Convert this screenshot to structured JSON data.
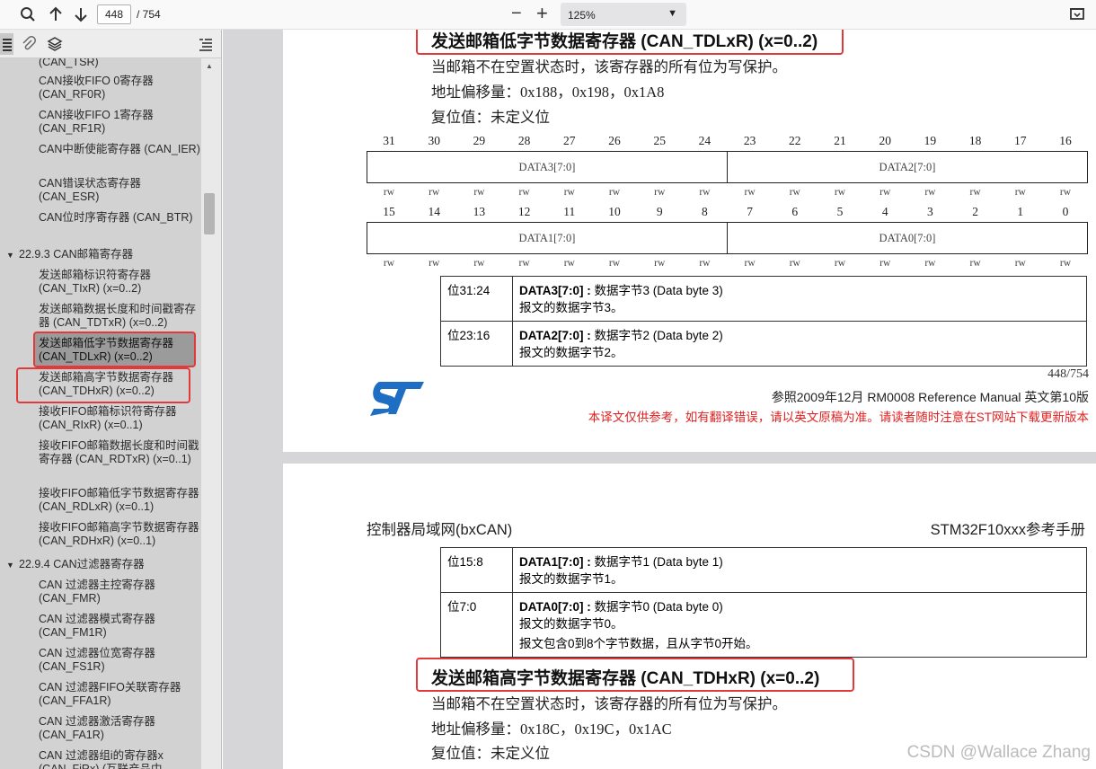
{
  "toolbar": {
    "page_number": "448",
    "page_total": "/ 754",
    "zoom": "125%",
    "zoom_out": "−",
    "zoom_in": "+"
  },
  "outline": {
    "items": [
      {
        "text": "(CAN_TSR)",
        "top": 0,
        "type": "item"
      },
      {
        "text": "CAN接收FIFO 0寄存器 (CAN_RF0R)",
        "type": "item"
      },
      {
        "text": "CAN接收FIFO 1寄存器 (CAN_RF1R)",
        "type": "item"
      },
      {
        "text": "CAN中断使能寄存器 (CAN_IER)",
        "type": "item"
      },
      {
        "text": "CAN错误状态寄存器 (CAN_ESR)",
        "type": "item"
      },
      {
        "text": "CAN位时序寄存器 (CAN_BTR)",
        "type": "item"
      }
    ],
    "sec_2293": "22.9.3 CAN邮箱寄存器",
    "mailbox_items": [
      "发送邮箱标识符寄存器 (CAN_TIxR) (x=0..2)",
      "发送邮箱数据长度和时间戳寄存器 (CAN_TDTxR) (x=0..2)",
      "发送邮箱低字节数据寄存器 (CAN_TDLxR) (x=0..2)",
      "发送邮箱高字节数据寄存器 (CAN_TDHxR) (x=0..2)",
      "接收FIFO邮箱标识符寄存器 (CAN_RIxR) (x=0..1)",
      "接收FIFO邮箱数据长度和时间戳寄存器 (CAN_RDTxR) (x=0..1)",
      "接收FIFO邮箱低字节数据寄存器 (CAN_RDLxR) (x=0..1)",
      "接收FIFO邮箱高字节数据寄存器 (CAN_RDHxR) (x=0..1)"
    ],
    "sec_2294": "22.9.4 CAN过滤器寄存器",
    "filter_items": [
      "CAN 过滤器主控寄存器 (CAN_FMR)",
      "CAN 过滤器模式寄存器 (CAN_FM1R)",
      "CAN 过滤器位宽寄存器 (CAN_FS1R)",
      "CAN 过滤器FIFO关联寄存器 (CAN_FFA1R)",
      "CAN 过滤器激活寄存器 (CAN_FA1R)",
      "CAN 过滤器组i的寄存器x (CAN_FiRx) (互联产品中"
    ]
  },
  "page1": {
    "title": "发送邮箱低字节数据寄存器 (CAN_TDLxR) (x=0..2)",
    "desc": "当邮箱不在空置状态时，该寄存器的所有位为写保护。",
    "offset": "地址偏移量：0x188，0x198，0x1A8",
    "reset": "复位值：未定义位",
    "bits_hi": [
      "31",
      "30",
      "29",
      "28",
      "27",
      "26",
      "25",
      "24",
      "23",
      "22",
      "21",
      "20",
      "19",
      "18",
      "17",
      "16"
    ],
    "bits_lo": [
      "15",
      "14",
      "13",
      "12",
      "11",
      "10",
      "9",
      "8",
      "7",
      "6",
      "5",
      "4",
      "3",
      "2",
      "1",
      "0"
    ],
    "rw": "rw",
    "field_a": "DATA3[7:0]",
    "field_b": "DATA2[7:0]",
    "field_c": "DATA1[7:0]",
    "field_d": "DATA0[7:0]",
    "rows": [
      {
        "bit": "位31:24",
        "name": "DATA3[7:0] :",
        "desc": " 数据字节3 (Data byte 3)",
        "sub": "报文的数据字节3。"
      },
      {
        "bit": "位23:16",
        "name": "DATA2[7:0] :",
        "desc": " 数据字节2 (Data byte 2)",
        "sub": "报文的数据字节2。"
      }
    ],
    "page_no": "448/754",
    "ref": "参照2009年12月 RM0008 Reference Manual  英文第10版",
    "disclaimer": "本译文仅供参考，如有翻译错误，请以英文原稿为准。请读者随时注意在ST网站下载更新版本"
  },
  "page2": {
    "header_left": "控制器局域网(bxCAN)",
    "header_right": "STM32F10xxx参考手册",
    "rows": [
      {
        "bit": "位15:8",
        "name": "DATA1[7:0] :",
        "desc": " 数据字节1 (Data byte 1)",
        "sub": "报文的数据字节1。",
        "sub2": ""
      },
      {
        "bit": "位7:0",
        "name": "DATA0[7:0] :",
        "desc": " 数据字节0 (Data byte 0)",
        "sub": "报文的数据字节0。",
        "sub2": "报文包含0到8个字节数据，且从字节0开始。"
      }
    ],
    "title": "发送邮箱高字节数据寄存器 (CAN_TDHxR) (x=0..2)",
    "desc": "当邮箱不在空置状态时，该寄存器的所有位为写保护。",
    "offset": "地址偏移量：0x18C，0x19C，0x1AC",
    "reset": "复位值：未定义位"
  },
  "watermark": "CSDN @Wallace Zhang",
  "colors": {
    "highlight": "#e23a3a",
    "st_blue": "#1e6fc4",
    "disclaimer": "#e02020"
  }
}
